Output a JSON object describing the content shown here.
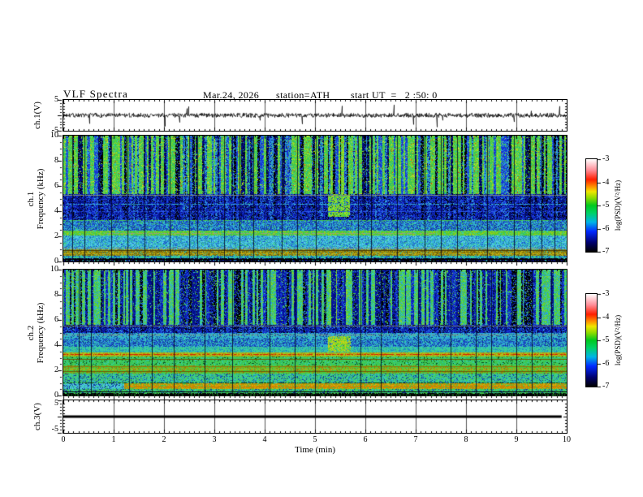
{
  "header": {
    "title": "VLF Spectra",
    "date": "Mar.24, 2026",
    "station": "station=ATH",
    "start_ut": "start UT  =   2 :50: 0"
  },
  "axes": {
    "time": {
      "label": "Time  (min)",
      "tick_labels": [
        "0",
        "1",
        "2",
        "3",
        "4",
        "5",
        "6",
        "7",
        "8",
        "9",
        "10"
      ],
      "range": [
        0,
        10
      ],
      "minor_step": 0.1
    },
    "wave_y": {
      "label": "ch.1(V)",
      "tick_labels": [
        "5",
        "-5"
      ],
      "range": [
        -5,
        5
      ]
    },
    "spec1_y": {
      "line1": "ch.1",
      "line2": "Frequency  (kHz)",
      "tick_labels": [
        "10",
        "8",
        "6",
        "4",
        "2",
        "0"
      ],
      "range": [
        0,
        10
      ]
    },
    "spec2_y": {
      "line1": "ch.2",
      "line2": "Frequency  (kHz)",
      "tick_labels": [
        "10",
        "8",
        "6",
        "4",
        "2",
        "0"
      ],
      "range": [
        0,
        10
      ]
    },
    "ch3_y": {
      "label": "ch.3(V)",
      "tick_labels": [
        "5",
        "-5"
      ],
      "range": [
        -5,
        5
      ]
    }
  },
  "colorbar": {
    "label": "log(PSD)(V²/Hz)",
    "tick_labels": [
      "-3",
      "-4",
      "-5",
      "-6",
      "-7"
    ],
    "range": [
      -7,
      -3
    ],
    "stops": [
      [
        0,
        "#000000"
      ],
      [
        0.1,
        "#00006e"
      ],
      [
        0.22,
        "#0028ff"
      ],
      [
        0.32,
        "#00b4e6"
      ],
      [
        0.42,
        "#00d264"
      ],
      [
        0.5,
        "#00c81e"
      ],
      [
        0.58,
        "#8cdc00"
      ],
      [
        0.65,
        "#f0e600"
      ],
      [
        0.7,
        "#ff9600"
      ],
      [
        0.78,
        "#ff1e00"
      ],
      [
        0.88,
        "#ff8c96"
      ],
      [
        1,
        "#ffffff"
      ]
    ]
  },
  "chart_data": [
    {
      "type": "line",
      "panel": "waveform",
      "channel": "ch.1(V)",
      "yrange": [
        -5,
        5
      ],
      "xrange": [
        0,
        10
      ],
      "baseline": 0,
      "noise_amp_v": 0.75,
      "spike_prob": 0.03,
      "spike_max_v": 4.5,
      "seed": 7,
      "grid_major_min": 1
    },
    {
      "type": "heatmap",
      "panel": "spectrogram-ch1",
      "channel": "ch.1",
      "xrange": [
        0,
        10
      ],
      "yrange": [
        0,
        10
      ],
      "seed": 11,
      "streak_dark_prob": 0.48,
      "streak_colors": [
        "#020d86",
        "#000000",
        "#1535d6",
        "#2f9bdd"
      ],
      "regions": [
        {
          "f": [
            5.35,
            10
          ],
          "colors": [
            "#3ec94f",
            "#52d23c",
            "#8fd425",
            "#2fc06a",
            "#35ccb0",
            "#aede1f",
            "#d43a10",
            "#e8e12a"
          ],
          "weights": [
            30,
            20,
            14,
            12,
            8,
            8,
            2,
            3
          ],
          "streaks": true
        },
        {
          "f": [
            3.3,
            5.35
          ],
          "colors": [
            "#0a1cb0",
            "#1535d6",
            "#050a66",
            "#000000",
            "#2b59e8",
            "#35b3d6"
          ],
          "weights": [
            30,
            22,
            18,
            12,
            10,
            4
          ],
          "streaks": "faint"
        },
        {
          "f": [
            2.45,
            3.3
          ],
          "colors": [
            "#1d53cc",
            "#2f9bdd",
            "#123a99",
            "#35ccc0",
            "#44cc55"
          ],
          "weights": [
            28,
            25,
            20,
            17,
            6
          ]
        },
        {
          "f": [
            2.05,
            2.45
          ],
          "colors": [
            "#57cc2d",
            "#9ccc17",
            "#38c460",
            "#35ccb0"
          ],
          "weights": [
            35,
            25,
            22,
            10
          ]
        },
        {
          "f": [
            1.0,
            2.05
          ],
          "colors": [
            "#37b7dd",
            "#5bcfe8",
            "#2389c4",
            "#3ecb8a",
            "#1d53cc"
          ],
          "weights": [
            30,
            22,
            18,
            15,
            10
          ]
        },
        {
          "f": [
            0.45,
            1.0
          ],
          "colors": [
            "#8a7a10",
            "#a89a0e",
            "#6b5c08",
            "#c4b414",
            "#35b099"
          ],
          "weights": [
            28,
            24,
            20,
            12,
            12
          ]
        },
        {
          "f": [
            0.28,
            0.45
          ],
          "colors": [
            "#35ccb0",
            "#3ecb8a",
            "#2389c4",
            "#0a1cb0"
          ],
          "weights": [
            35,
            25,
            22,
            15
          ]
        },
        {
          "f": [
            0,
            0.28
          ],
          "colors": [
            "#000000",
            "#050a44",
            "#0a1cb0",
            "#35ccb0"
          ],
          "weights": [
            55,
            20,
            15,
            8
          ]
        }
      ],
      "h_lines": [
        {
          "f": 5.28,
          "color": "#7d8d7d",
          "style": "solid"
        },
        {
          "f": 4.6,
          "color": "#35b3d6",
          "style": "dotted"
        },
        {
          "f": 4.0,
          "color": "#2b59e8",
          "style": "dotted"
        },
        {
          "f": 3.32,
          "color": "#44cc55",
          "style": "dotted"
        },
        {
          "f": 2.25,
          "color": "#9a9a88",
          "style": "dotted",
          "t": [
            0.8,
            7.4
          ]
        },
        {
          "f": 1.08,
          "color": "#8d8d75",
          "style": "dotted"
        },
        {
          "f": 0.88,
          "color": "#4a3d05",
          "style": "solid"
        },
        {
          "f": 0.62,
          "color": "#c4b414",
          "style": "dotted"
        },
        {
          "f": 0.18,
          "color": "#000000",
          "style": "solid"
        }
      ],
      "event": {
        "t": [
          5.25,
          5.68
        ],
        "f": [
          3.55,
          5.35
        ],
        "colors": [
          "#4ad23c",
          "#8fd425",
          "#b4e01c",
          "#35c96a"
        ]
      },
      "event_col_tint": {
        "t": [
          5.28,
          5.64
        ],
        "f": [
          5.35,
          10
        ],
        "colors": [
          "#8fd425",
          "#aede1f",
          "#52d23c"
        ]
      },
      "impulses": {
        "times": [
          0.18,
          0.42,
          0.95,
          1.28,
          1.62,
          2.12,
          2.5,
          2.66,
          3.2,
          3.5,
          3.78,
          4.34,
          4.65,
          5.02,
          5.85,
          6.12,
          6.63,
          7.18,
          7.5,
          7.82,
          8.42,
          8.95,
          9.28,
          9.5,
          9.75
        ],
        "color": "#00041c"
      }
    },
    {
      "type": "heatmap",
      "panel": "spectrogram-ch2",
      "channel": "ch.2",
      "xrange": [
        0,
        10
      ],
      "yrange": [
        0,
        10
      ],
      "seed": 23,
      "streak_dark_prob": 0.55,
      "streak_colors": [
        "#020d86",
        "#0a1cb0",
        "#000000",
        "#1535d6"
      ],
      "regions": [
        {
          "f": [
            5.6,
            10
          ],
          "colors": [
            "#35ccb0",
            "#3ec94f",
            "#52d23c",
            "#2f9bdd",
            "#8fd425"
          ],
          "weights": [
            26,
            24,
            18,
            18,
            14
          ],
          "streaks": true
        },
        {
          "f": [
            4.95,
            5.6
          ],
          "colors": [
            "#0a1cb0",
            "#1535d6",
            "#050a66",
            "#2f9bdd",
            "#000000"
          ],
          "weights": [
            28,
            24,
            18,
            18,
            12
          ],
          "streaks": "faint"
        },
        {
          "f": [
            4.5,
            4.95
          ],
          "colors": [
            "#35b3d6",
            "#2f9bdd",
            "#123a99",
            "#35ccb0"
          ],
          "weights": [
            30,
            26,
            22,
            22
          ]
        },
        {
          "f": [
            3.85,
            4.5
          ],
          "colors": [
            "#1d53cc",
            "#2f9bdd",
            "#35ccb0",
            "#123a99"
          ],
          "weights": [
            30,
            26,
            24,
            20
          ]
        },
        {
          "f": [
            3.45,
            3.85
          ],
          "colors": [
            "#3ecb8a",
            "#35ccb0",
            "#2389c4"
          ],
          "weights": [
            40,
            35,
            25
          ]
        },
        {
          "f": [
            3.1,
            3.45
          ],
          "colors": [
            "#c4b414",
            "#a89a0e",
            "#8fd425",
            "#cc7a00"
          ],
          "weights": [
            32,
            26,
            26,
            16
          ]
        },
        {
          "f": [
            2.4,
            3.1
          ],
          "colors": [
            "#3ec94f",
            "#44cc55",
            "#2fc06a",
            "#35ccb0",
            "#0f4d1a"
          ],
          "weights": [
            30,
            26,
            20,
            14,
            10
          ]
        },
        {
          "f": [
            1.75,
            2.4
          ],
          "colors": [
            "#57cc2d",
            "#3ec94f",
            "#8a7a10",
            "#a89a0e"
          ],
          "weights": [
            34,
            28,
            20,
            18
          ]
        },
        {
          "f": [
            0.95,
            1.75
          ],
          "colors": [
            "#3ecb8a",
            "#44cc55",
            "#35ccb0",
            "#2389c4",
            "#123a99"
          ],
          "weights": [
            28,
            26,
            20,
            14,
            12
          ]
        },
        {
          "f": [
            0.5,
            0.95
          ],
          "t": [
            0,
            1.2
          ],
          "colors": [
            "#35b3d6",
            "#5bcfe8",
            "#123a99",
            "#3ecb8a"
          ],
          "weights": [
            34,
            26,
            20,
            20
          ]
        },
        {
          "f": [
            0.5,
            0.95
          ],
          "colors": [
            "#cc8a00",
            "#dda90a",
            "#a89a0e",
            "#3ec94f"
          ],
          "weights": [
            32,
            28,
            22,
            18
          ]
        },
        {
          "f": [
            0.22,
            0.5
          ],
          "colors": [
            "#3ec94f",
            "#35ccb0",
            "#44cc55",
            "#123a99"
          ],
          "weights": [
            32,
            26,
            24,
            18
          ]
        },
        {
          "f": [
            0,
            0.22
          ],
          "colors": [
            "#000000",
            "#0a3d12",
            "#3ec94f"
          ],
          "weights": [
            50,
            25,
            25
          ]
        }
      ],
      "h_lines": [
        {
          "f": 5.52,
          "color": "#6b7b6b",
          "style": "solid"
        },
        {
          "f": 4.82,
          "color": "#8d8d75",
          "style": "dotted"
        },
        {
          "f": 3.28,
          "color": "#d42105",
          "style": "dotted"
        },
        {
          "f": 2.92,
          "color": "#6b5c08",
          "style": "solid"
        },
        {
          "f": 2.3,
          "color": "#8a7a10",
          "style": "solid"
        },
        {
          "f": 2.12,
          "color": "#c4b414",
          "style": "dotted"
        },
        {
          "f": 1.95,
          "color": "#6b5c08",
          "style": "solid"
        },
        {
          "f": 1.05,
          "color": "#0a3d12",
          "style": "dotted"
        },
        {
          "f": 0.68,
          "color": "#cc7a00",
          "style": "solid",
          "t": [
            1.2,
            10
          ]
        },
        {
          "f": 0.3,
          "color": "#000000",
          "style": "solid"
        },
        {
          "f": 0.12,
          "color": "#000000",
          "style": "solid"
        },
        {
          "f": 0.03,
          "color": "#7a1505",
          "style": "solid"
        }
      ],
      "event": {
        "t": [
          5.25,
          5.7
        ],
        "f": [
          3.5,
          4.7
        ],
        "colors": [
          "#8fd425",
          "#b4e01c",
          "#4ad23c",
          "#d4c414"
        ]
      },
      "event_col_tint": {
        "t": [
          5.28,
          5.64
        ],
        "f": [
          5.6,
          10
        ],
        "colors": [
          "#8fd425",
          "#52d23c",
          "#aede1f"
        ]
      },
      "impulses": {
        "times": [
          0.3,
          0.55,
          1.3,
          1.75,
          2.2,
          2.8,
          3.35,
          4.1,
          4.6,
          5.0,
          5.9,
          6.3,
          7.05,
          7.7,
          8.2,
          8.5,
          9.0,
          9.3,
          9.7
        ],
        "color": "#00041c"
      }
    },
    {
      "type": "line",
      "panel": "ch3",
      "channel": "ch.3(V)",
      "yrange": [
        -5,
        5
      ],
      "xrange": [
        0,
        10
      ],
      "value": 0,
      "t_extent": [
        0,
        9.9
      ],
      "line_thickness_px": 3,
      "grid_major_min": 1
    }
  ]
}
